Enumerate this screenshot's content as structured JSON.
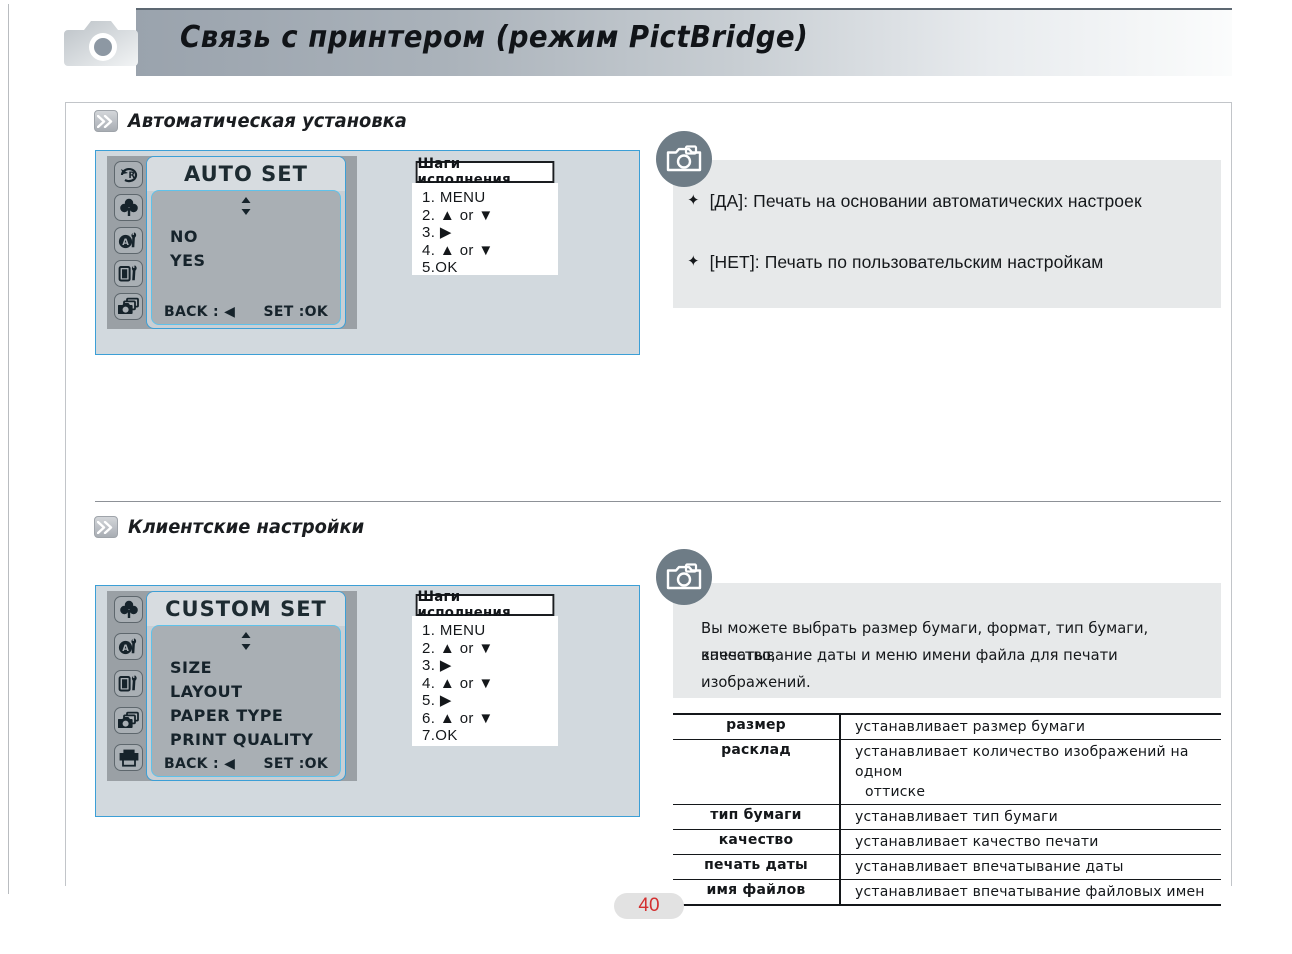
{
  "header": {
    "title": "Связь с принтером (режим PictBridge)",
    "camera_icon": "camera-icon"
  },
  "sections": [
    {
      "id": "auto-set",
      "chevron_icon": "double-chevron-right-icon",
      "title": "Автоматическая установка",
      "lcd": {
        "screen_title": "AUTO SET",
        "updown_icon": "up-down-arrows-icon",
        "options": [
          "NO",
          "YES"
        ],
        "footer_left": "BACK : ◀",
        "footer_right": "SET :OK",
        "rail_icons": [
          "rotate-r-icon",
          "clover-icon",
          "auto-setup-wrench-icon",
          "card-setup-wrench-icon",
          "pictbridge-camera-icon"
        ]
      },
      "steps": {
        "header": "Шаги исполнения",
        "lines": [
          "1. MENU",
          "2. ▲ or  ▼",
          "3. ▶",
          "4. ▲  or  ▼",
          "5.OK"
        ]
      },
      "note": {
        "badge_icon": "camera-icon",
        "bullets": [
          {
            "star": "✦",
            "text": "[ДА]:  Печать на основании автоматических настроек"
          },
          {
            "star": "✦",
            "text": "[НЕТ]: Печать по пользовательским настройкам"
          }
        ]
      }
    },
    {
      "id": "custom-set",
      "chevron_icon": "double-chevron-right-icon",
      "title": "Клиентские настройки",
      "lcd": {
        "screen_title": "CUSTOM SET",
        "updown_icon": "up-down-arrows-icon",
        "options": [
          "SIZE",
          "LAYOUT",
          "PAPER TYPE",
          "PRINT QUALITY"
        ],
        "footer_left": "BACK : ◀",
        "footer_right": "SET :OK",
        "rail_icons": [
          "clover-icon",
          "auto-setup-wrench-icon",
          "card-setup-wrench-icon",
          "pictbridge-camera-icon",
          "printer-icon"
        ]
      },
      "steps": {
        "header": "Шаги исполнения",
        "lines": [
          "1. MENU",
          "2. ▲ or  ▼",
          "3. ▶",
          "4. ▲  or  ▼",
          "5. ▶",
          "6. ▲  or  ▼",
          "7.OK"
        ]
      },
      "note": {
        "badge_icon": "camera-icon",
        "paragraph_line1": "Вы можете выбрать размер бумаги, формат, тип бумаги, качество,",
        "paragraph_line2": "впечатывание даты и меню имени файла для печати изображений."
      }
    }
  ],
  "desc_table": {
    "rows": [
      {
        "term": "размер",
        "desc": "устанавливает размер бумаги",
        "desc_cont": ""
      },
      {
        "term": "расклад",
        "desc": "устанавливает количество изображений на одном",
        "desc_cont": "оттиске"
      },
      {
        "term": "тип бумаги",
        "desc": "устанавливает тип бумаги",
        "desc_cont": ""
      },
      {
        "term": "качество",
        "desc": "устанавливает качество печати",
        "desc_cont": ""
      },
      {
        "term": "печать даты",
        "desc": "устанавливает впечатывание даты",
        "desc_cont": ""
      },
      {
        "term": "имя файлов",
        "desc": "устанавливает впечатывание файловых имен",
        "desc_cont": ""
      }
    ]
  },
  "footer": {
    "page_number": "40"
  },
  "colors": {
    "lcd_border": "#3c9fd6",
    "lcd_body": "#9aa0a5",
    "note_panel": "#e7e9ea",
    "badge": "#6e7c86",
    "page_number": "#d32f2f"
  }
}
